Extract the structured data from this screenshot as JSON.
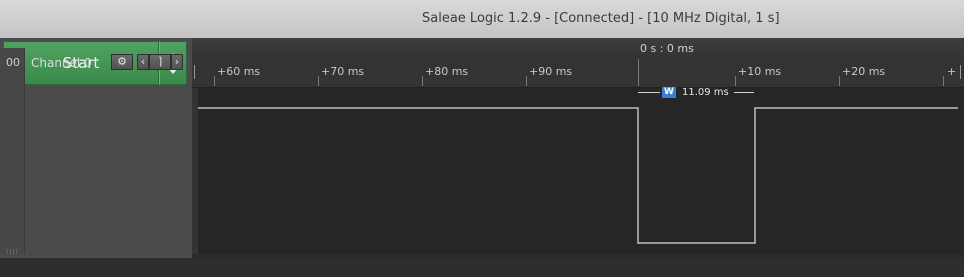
{
  "window": {
    "title": "Saleae Logic 1.2.9 - [Connected] - [10 MHz Digital, 1 s]"
  },
  "controls": {
    "start_label": "Start"
  },
  "timeline": {
    "origin_label": "0 s : 0 ms",
    "ticks": [
      "+60 ms",
      "+70 ms",
      "+80 ms",
      "+90 ms",
      "+10 ms",
      "+20 ms",
      "+"
    ]
  },
  "channels": [
    {
      "number": "00",
      "name": "Channel 0",
      "trigger_symbol": "⌉"
    }
  ],
  "measurement": {
    "badge": "W",
    "value": "11.09 ms"
  },
  "icons": {
    "gear": "gear-icon",
    "arrow_left": "chevron-left-icon",
    "arrow_right": "chevron-right-icon",
    "trigger": "falling-edge-trigger-icon"
  },
  "colors": {
    "start_green": "#44975a",
    "measure_blue": "#3a7fd6",
    "signal": "#bdbdbd"
  }
}
